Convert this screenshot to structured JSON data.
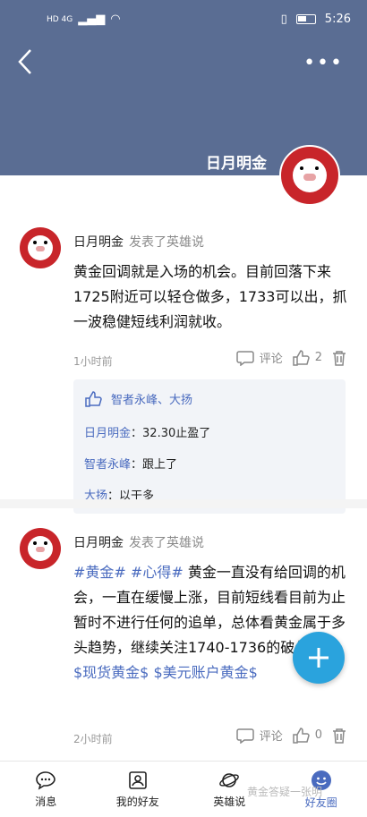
{
  "status": {
    "network": "HD 4G",
    "time": "5:26"
  },
  "header": {
    "name": "日月明金"
  },
  "posts": [
    {
      "author": "日月明金",
      "verb": "发表了英雄说",
      "body": "黄金回调就是入场的机会。目前回落下来1725附近可以轻仓做多，1733可以出，抓一波稳健短线利润就收。",
      "time": "1小时前",
      "comment_label": "评论",
      "like_count": "2",
      "likers": "智者永峰、大扬",
      "comments": [
        {
          "name": "日月明金",
          "sep": "：",
          "text": "32.30止盈了"
        },
        {
          "name": "智者永峰",
          "sep": "：",
          "text": "跟上了"
        },
        {
          "name": "大扬",
          "sep": "：",
          "text": "以干多"
        }
      ]
    },
    {
      "author": "日月明金",
      "verb": "发表了英雄说",
      "tag1": "#黄金#",
      "tag2": "#心得#",
      "body": "黄金一直没有给回调的机会，一直在缓慢上涨，目前短线看目前为止暂时不进行任何的追单，总体看黄金属于多头趋势，继续关注1740-1736的破位情况。",
      "tag3": "$现货黄金$",
      "tag4": "$美元账户黄金$",
      "time": "2小时前",
      "comment_label": "评论",
      "like_count": "0"
    }
  ],
  "tabs": [
    {
      "label": "消息",
      "icon": "message-icon"
    },
    {
      "label": "我的好友",
      "icon": "contacts-icon"
    },
    {
      "label": "英雄说",
      "icon": "planet-icon"
    },
    {
      "label": "好友圈",
      "icon": "smile-icon"
    }
  ],
  "watermark": "黄金答疑一张明",
  "colors": {
    "header": "#5a6d93",
    "accent": "#4a6bbf",
    "fab": "#2aa3dd",
    "avatar": "#c8252a"
  }
}
